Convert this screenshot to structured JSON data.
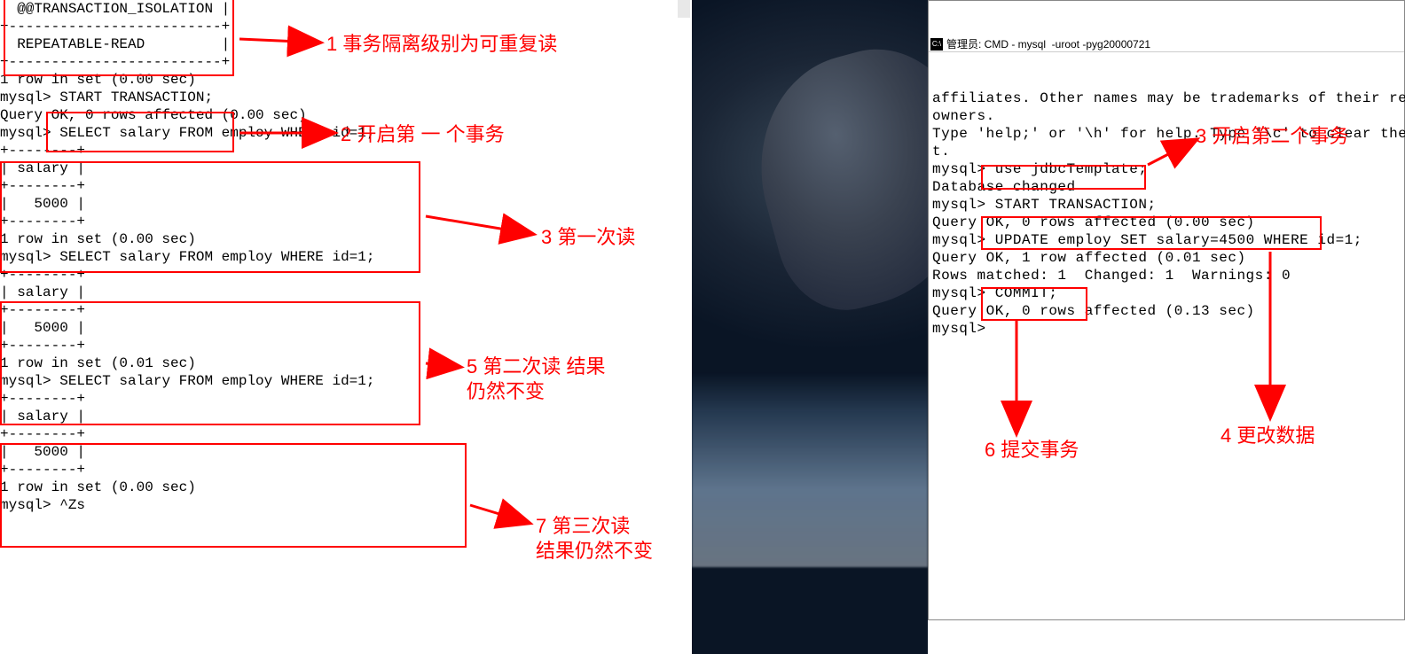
{
  "left": {
    "isolation_header": "| @@TRANSACTION_ISOLATION |",
    "isolation_sep": "+-------------------------+",
    "isolation_value": "| REPEATABLE-READ         |",
    "row1": "1 row in set (0.00 sec)",
    "prompt": "mysql>",
    "start_tx": "START TRANSACTION;",
    "query_ok0": "Query OK, 0 rows affected (0.00 sec)",
    "select_stmt": "SELECT salary FROM employ WHERE id=1;",
    "tbl_sep": "+--------+",
    "tbl_head": "| salary |",
    "tbl_val": "|   5000 |",
    "row_000": "1 row in set (0.00 sec)",
    "row_001": "1 row in set (0.01 sec)",
    "last_prompt": "mysql> ^Zs"
  },
  "right": {
    "title": "管理员: CMD - mysql  -uroot -pyg20000721",
    "affiliates": "affiliates. Other names may be trademarks of their re",
    "owners": "owners.",
    "help": "Type 'help;' or '\\h' for help. Type '\\c' to clear the",
    "help2": "t.",
    "prompt": "mysql>",
    "use": "use jdbcTemplate;",
    "dbchg": "Database changed",
    "start_tx": "START TRANSACTION;",
    "q_ok0": "Query OK, 0 rows affected (0.00 sec)",
    "update": "UPDATE employ SET salary=4500 WHERE id=1;",
    "q_ok1": "Query OK, 1 row affected (0.01 sec)",
    "rows_m": "Rows matched: 1  Changed: 1  Warnings: 0",
    "commit": "COMMIT;",
    "q_ok2": "Query OK, 0 rows affected (0.13 sec)",
    "last": "mysql>"
  },
  "annots": {
    "a1": "1  事务隔离级别为可重复读",
    "a2": "2 开启第 一 个事务",
    "a3": "3 第一次读",
    "a5_l1": "5 第二次读 结果",
    "a5_l2": "仍然不变",
    "a7_l1": "7 第三次读",
    "a7_l2": "结果仍然不变",
    "r3": "3 开启第二个事务",
    "r4": "4 更改数据",
    "r6": "6 提交事务"
  }
}
